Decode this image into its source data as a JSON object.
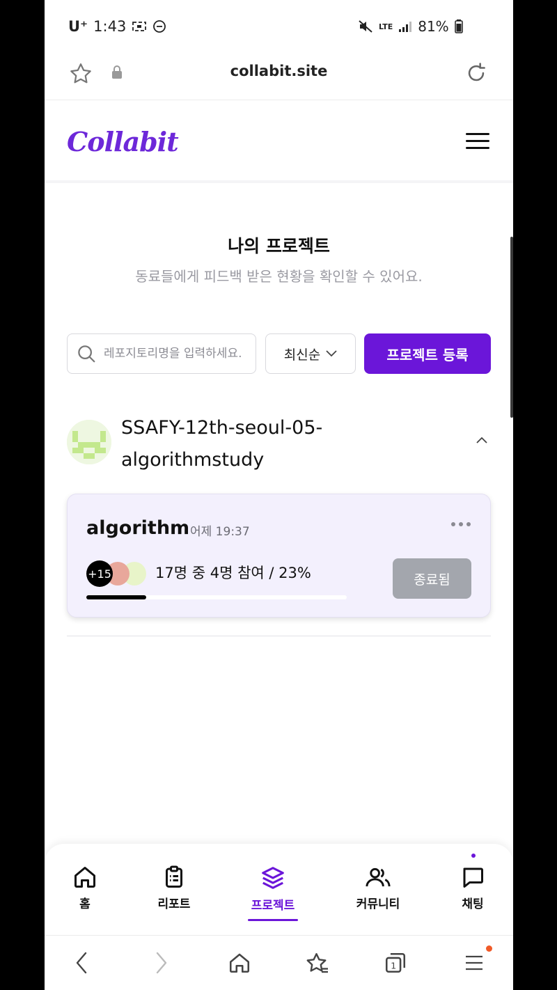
{
  "status_bar": {
    "carrier": "U⁺",
    "time": "1:43",
    "network": "LTE",
    "battery": "81%"
  },
  "browser": {
    "url": "collabit.site"
  },
  "site": {
    "logo": "Collabit"
  },
  "page": {
    "title": "나의 프로젝트",
    "subtitle": "동료들에게 피드백 받은 현황을 확인할 수 있어요."
  },
  "controls": {
    "search_placeholder": "레포지토리명을 입력하세요.",
    "sort_label": "최신순",
    "register_label": "프로젝트 등록"
  },
  "repo": {
    "name": "SSAFY-12th-seoul-05-algorithmstudy",
    "project": {
      "name": "algorithm",
      "time": "어제 19:37",
      "extra_participants": "+15",
      "stats": "17명 중 4명 참여 / 23%",
      "progress": 0.23,
      "status": "종료됨"
    }
  },
  "tabs": [
    {
      "label": "홈",
      "icon": "home-icon"
    },
    {
      "label": "리포트",
      "icon": "clipboard-icon"
    },
    {
      "label": "프로젝트",
      "icon": "layers-icon"
    },
    {
      "label": "커뮤니티",
      "icon": "users-icon"
    },
    {
      "label": "채팅",
      "icon": "chat-icon"
    }
  ],
  "colors": {
    "accent": "#6b16d9",
    "done_button": "#a3a6ad",
    "card_bg": "#f3f0fd"
  }
}
